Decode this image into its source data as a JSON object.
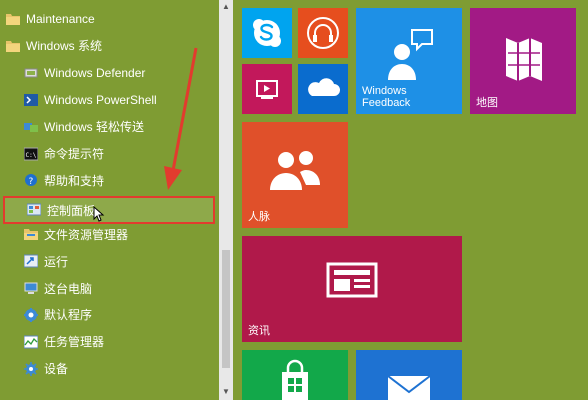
{
  "start_menu": {
    "apps": [
      {
        "label": "Maintenance",
        "icon": "folder-icon",
        "type": "folder"
      },
      {
        "label": "Windows 系统",
        "icon": "folder-icon",
        "type": "folder"
      },
      {
        "label": "Windows Defender",
        "icon": "defender-icon",
        "type": "sub"
      },
      {
        "label": "Windows PowerShell",
        "icon": "powershell-icon",
        "type": "sub"
      },
      {
        "label": "Windows 轻松传送",
        "icon": "easy-transfer-icon",
        "type": "sub"
      },
      {
        "label": "命令提示符",
        "icon": "cmd-icon",
        "type": "sub"
      },
      {
        "label": "帮助和支持",
        "icon": "help-icon",
        "type": "sub"
      },
      {
        "label": "控制面板",
        "icon": "control-panel-icon",
        "type": "highlight"
      },
      {
        "label": "文件资源管理器",
        "icon": "file-explorer-icon",
        "type": "sub"
      },
      {
        "label": "运行",
        "icon": "run-icon",
        "type": "sub"
      },
      {
        "label": "这台电脑",
        "icon": "this-pc-icon",
        "type": "sub"
      },
      {
        "label": "默认程序",
        "icon": "default-programs-icon",
        "type": "sub"
      },
      {
        "label": "任务管理器",
        "icon": "task-manager-icon",
        "type": "sub"
      },
      {
        "label": "设备",
        "icon": "devices-icon",
        "type": "sub"
      }
    ]
  },
  "tiles": {
    "windows_feedback": "Windows\nFeedback",
    "maps": "地图",
    "people": "人脉",
    "news": "资讯"
  },
  "colors": {
    "background": "#7f9c33",
    "skype": "#00a4ef",
    "music": "#e64e1e",
    "video": "#c2185b",
    "onedrive": "#0a6cce",
    "feedback": "#1e90e6",
    "maps": "#a21a85",
    "people": "#e0502a",
    "news": "#b0194a",
    "store": "#12a84a",
    "mail": "#1e72d2",
    "highlight_border": "#e23b2e"
  }
}
